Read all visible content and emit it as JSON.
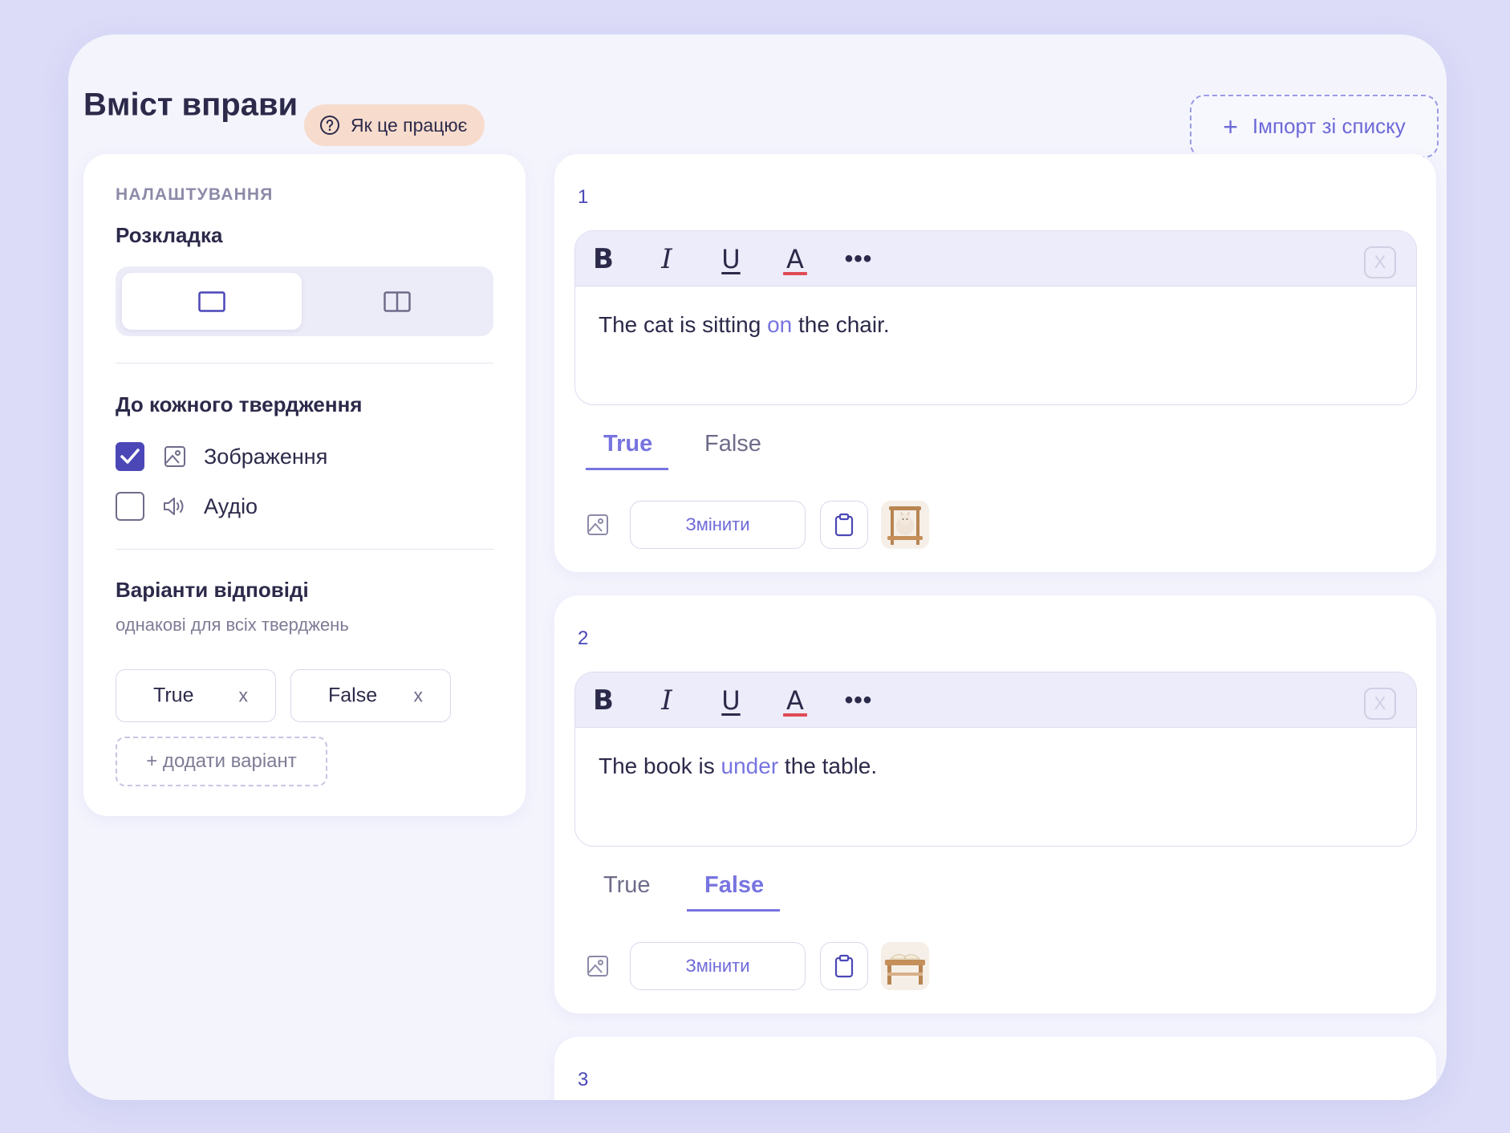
{
  "header": {
    "title": "Вміст вправи",
    "help_label": "Як це працює",
    "import_label": "Імпорт зі списку"
  },
  "settings": {
    "caption": "НАЛАШТУВАННЯ",
    "layout_title": "Розкладка",
    "each_statement_title": "До кожного твердження",
    "options": [
      {
        "label": "Зображення",
        "checked": true,
        "icon": "image-icon"
      },
      {
        "label": "Аудіо",
        "checked": false,
        "icon": "speaker-icon"
      }
    ],
    "answers_title": "Варіанти відповіді",
    "answers_note": "однакові для всіх тверджень",
    "chips": [
      {
        "label": "True",
        "remove": "x"
      },
      {
        "label": "False",
        "remove": "x"
      }
    ],
    "add_variant_label": "+ додати варіант"
  },
  "statements": [
    {
      "number": "1",
      "text_before": "The cat is sitting ",
      "highlight": "on",
      "text_after": " the chair.",
      "answers": [
        "True",
        "False"
      ],
      "selected": "True",
      "change_label": "Змінити",
      "thumbnail": "cat-on-chair"
    },
    {
      "number": "2",
      "text_before": "The book is ",
      "highlight": "under",
      "text_after": " the table.",
      "answers": [
        "True",
        "False"
      ],
      "selected": "False",
      "change_label": "Змінити",
      "thumbnail": "book-on-table"
    },
    {
      "number": "3"
    }
  ],
  "toolbar": {
    "bold": "B",
    "italic": "I",
    "underline": "U",
    "color": "A",
    "more": "•••",
    "close": "X"
  },
  "colors": {
    "accent": "#7774e0",
    "primary": "#4b47b7",
    "help_pill": "#f7dccd",
    "background": "#dcdcf8"
  }
}
